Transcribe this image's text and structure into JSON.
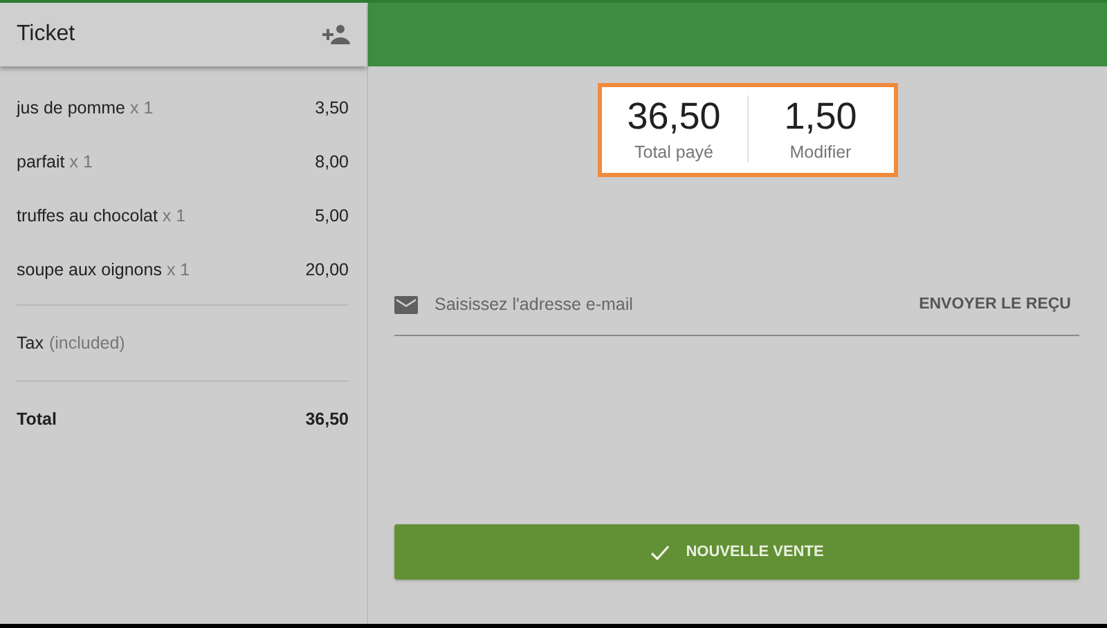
{
  "ticket": {
    "title": "Ticket",
    "items": [
      {
        "name": "jus de pomme",
        "quantity": "x 1",
        "price": "3,50"
      },
      {
        "name": "parfait",
        "quantity": "x 1",
        "price": "8,00"
      },
      {
        "name": "truffes au chocolat",
        "quantity": "x 1",
        "price": "5,00"
      },
      {
        "name": "soupe aux oignons",
        "quantity": "x 1",
        "price": "20,00"
      }
    ],
    "tax": {
      "label": "Tax",
      "note": "(included)"
    },
    "total": {
      "label": "Total",
      "value": "36,50"
    }
  },
  "payment": {
    "summary": [
      {
        "value": "36,50",
        "label": "Total payé"
      },
      {
        "value": "1,50",
        "label": "Modifier"
      }
    ],
    "email": {
      "placeholder": "Saisissez l'adresse e-mail",
      "action": "ENVOYER LE REÇU"
    },
    "new_sale": "NOUVELLE VENTE"
  }
}
